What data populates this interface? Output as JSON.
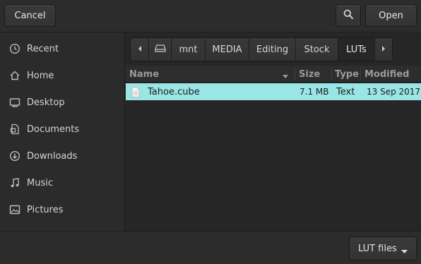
{
  "header": {
    "cancel_label": "Cancel",
    "search_icon": "search-icon",
    "open_label": "Open"
  },
  "sidebar": {
    "items": [
      {
        "label": "Recent",
        "icon": "clock-icon"
      },
      {
        "label": "Home",
        "icon": "home-icon"
      },
      {
        "label": "Desktop",
        "icon": "desktop-icon"
      },
      {
        "label": "Documents",
        "icon": "document-icon"
      },
      {
        "label": "Downloads",
        "icon": "download-icon"
      },
      {
        "label": "Music",
        "icon": "music-icon"
      },
      {
        "label": "Pictures",
        "icon": "picture-icon"
      }
    ]
  },
  "pathbar": {
    "crumbs": [
      "mnt",
      "MEDIA",
      "Editing",
      "Stock",
      "LUTs"
    ]
  },
  "filelist": {
    "columns": [
      "Name",
      "Size",
      "Type",
      "Modified"
    ],
    "rows": [
      {
        "name": "Tahoe.cube",
        "size": "7.1 MB",
        "type": "Text",
        "modified": "13 Sep 2017"
      }
    ]
  },
  "footer": {
    "filter_label": "LUT files"
  },
  "colors": {
    "selection": "#9ae6e6",
    "background": "#262626"
  }
}
